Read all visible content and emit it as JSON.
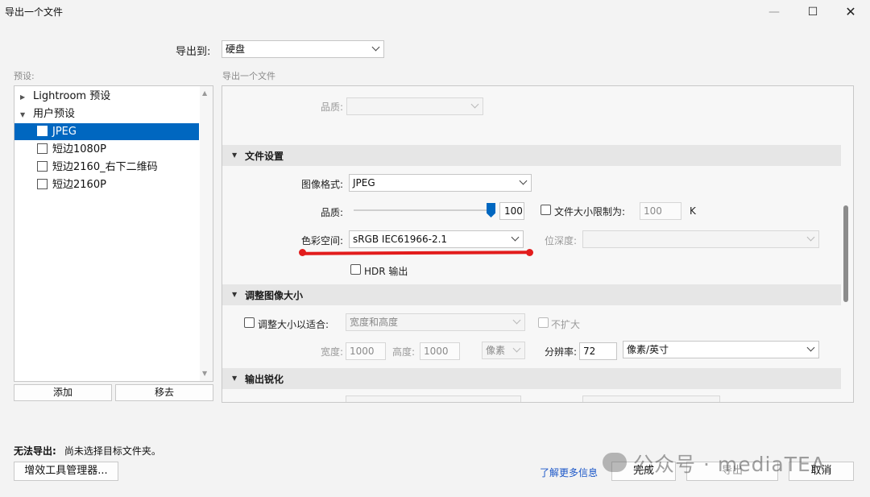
{
  "window": {
    "title": "导出一个文件",
    "minimize": "—",
    "maximize": "☐",
    "close": "✕"
  },
  "export_to": {
    "label": "导出到:",
    "value": "硬盘"
  },
  "presets": {
    "caption": "预设:",
    "items": [
      {
        "label": "Lightroom 预设",
        "type": "folder",
        "expanded": false
      },
      {
        "label": "用户预设",
        "type": "folder",
        "expanded": true
      },
      {
        "label": "JPEG",
        "type": "preset",
        "selected": true
      },
      {
        "label": "短边1080P",
        "type": "preset",
        "selected": false
      },
      {
        "label": "短边2160_右下二维码",
        "type": "preset",
        "selected": false
      },
      {
        "label": "短边2160P",
        "type": "preset",
        "selected": false
      }
    ],
    "add_label": "添加",
    "remove_label": "移去"
  },
  "main": {
    "caption": "导出一个文件",
    "top_quality_label": "品质:",
    "file_settings": {
      "title": "文件设置",
      "format_label": "图像格式:",
      "format_value": "JPEG",
      "quality_label": "品质:",
      "quality_value": "100",
      "quality_fraction": 1.0,
      "limit_label": "文件大小限制为:",
      "limit_value": "100",
      "limit_unit": "K",
      "colorspace_label": "色彩空间:",
      "colorspace_value": "sRGB IEC61966-2.1",
      "bitdepth_label": "位深度:",
      "hdr_label": "HDR 输出"
    },
    "resize": {
      "title": "调整图像大小",
      "fit_label": "调整大小以适合:",
      "fit_value": "宽度和高度",
      "no_enlarge_label": "不扩大",
      "width_label": "宽度:",
      "width_value": "1000",
      "height_label": "高度:",
      "height_value": "1000",
      "unit_value": "像素",
      "resolution_label": "分辨率:",
      "resolution_value": "72",
      "resolution_unit": "像素/英寸"
    },
    "sharpen": {
      "title": "输出锐化"
    }
  },
  "footer": {
    "warning_title": "无法导出:",
    "warning_text": "尚未选择目标文件夹。",
    "plugin_manager": "增效工具管理器...",
    "learn_more": "了解更多信息",
    "done": "完成",
    "export": "导出",
    "cancel": "取消",
    "watermark": "公众号 · mediaTEA"
  },
  "colors": {
    "accent": "#0067c0",
    "annotation": "#e21c1c",
    "link": "#1a56c8"
  }
}
